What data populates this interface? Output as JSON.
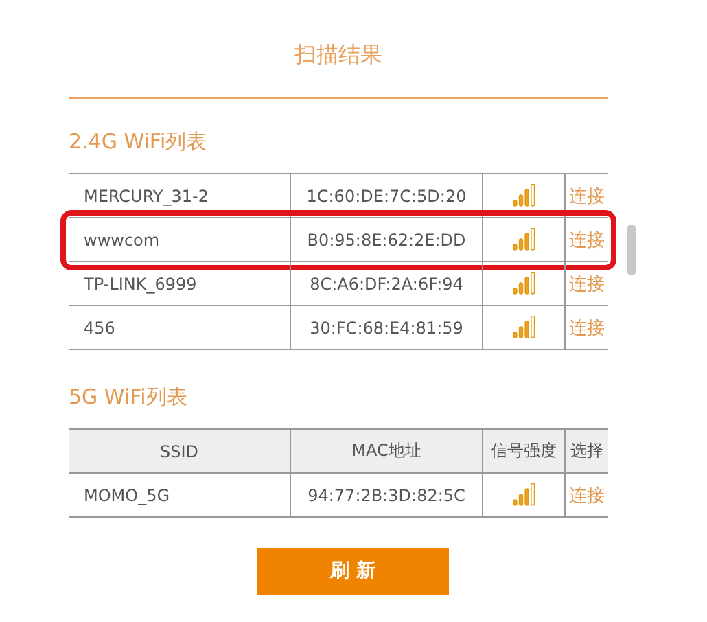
{
  "title": "扫描结果",
  "sections": [
    {
      "heading": "2.4G WiFi列表",
      "scrollable": true,
      "rows": [
        {
          "ssid": "MERCURY_31-2",
          "mac": "1C:60:DE:7C:5D:20",
          "action": "连接",
          "highlighted": false
        },
        {
          "ssid": "wwwcom",
          "mac": "B0:95:8E:62:2E:DD",
          "action": "连接",
          "highlighted": true
        },
        {
          "ssid": "TP-LINK_6999",
          "mac": "8C:A6:DF:2A:6F:94",
          "action": "连接",
          "highlighted": false
        },
        {
          "ssid": "456",
          "mac": "30:FC:68:E4:81:59",
          "action": "连接",
          "highlighted": false
        }
      ]
    },
    {
      "heading": "5G WiFi列表",
      "scrollable": false,
      "columns": [
        "SSID",
        "MAC地址",
        "信号强度",
        "选择"
      ],
      "rows": [
        {
          "ssid": "MOMO_5G",
          "mac": "94:77:2B:3D:82:5C",
          "action": "连接"
        }
      ]
    }
  ],
  "refresh_button": "刷 新"
}
